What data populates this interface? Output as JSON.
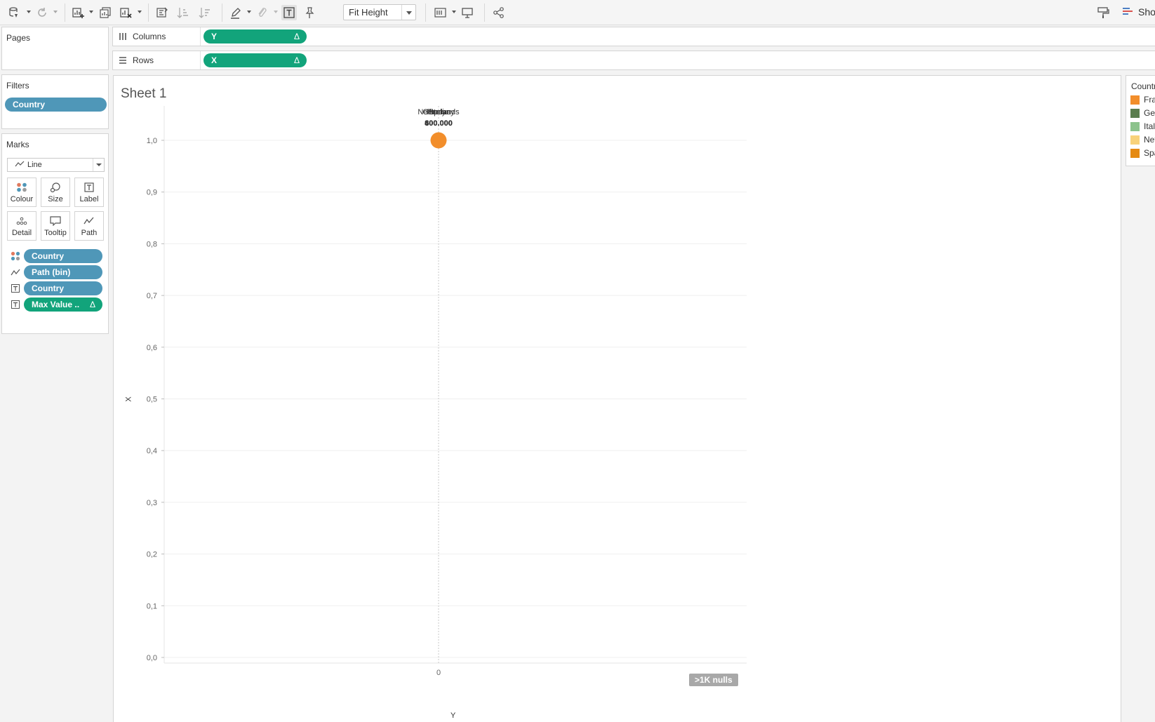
{
  "toolbar": {
    "fit_label": "Fit Height",
    "show_me_label": "Show Me"
  },
  "panels": {
    "pages_title": "Pages",
    "filters_title": "Filters",
    "filters": [
      "Country"
    ],
    "marks_title": "Marks",
    "mark_type": "Line",
    "mark_buttons": [
      "Colour",
      "Size",
      "Label",
      "Detail",
      "Tooltip",
      "Path"
    ],
    "mark_fields": [
      {
        "label": "Country",
        "icon": "colour-icon",
        "color": "#4f97b8"
      },
      {
        "label": "Path (bin)",
        "icon": "path-icon",
        "color": "#4f97b8"
      },
      {
        "label": "Country",
        "icon": "label-icon",
        "color": "#4f97b8"
      },
      {
        "label": "Max Value ..",
        "icon": "label-icon",
        "color": "#12a47b",
        "delta": "Δ"
      }
    ]
  },
  "shelves": {
    "columns_label": "Columns",
    "columns_pill": "Y",
    "rows_label": "Rows",
    "rows_pill": "X",
    "delta": "Δ"
  },
  "sheet": {
    "title": "Sheet 1",
    "nulls_badge": ">1K nulls"
  },
  "chart_data": {
    "type": "scatter",
    "xlabel": "Y",
    "ylabel": "X",
    "x_ticks": [
      "0"
    ],
    "y_ticks": [
      "1,0",
      "0,9",
      "0,8",
      "0,7",
      "0,6",
      "0,5",
      "0,4",
      "0,3",
      "0,2",
      "0,1",
      "0,0"
    ],
    "ylim": [
      0,
      1
    ],
    "points": [
      {
        "x": 0,
        "y": 1.0,
        "color": "#f28e2b"
      }
    ],
    "overlapping_labels": [
      "Netherlands",
      "Germany",
      "Spain",
      "France",
      "Italy"
    ],
    "overlapping_values": [
      "800.000",
      "600.000",
      "400.000"
    ]
  },
  "legend": {
    "title": "Country",
    "items": [
      {
        "label": "France",
        "color": "#f28e2b"
      },
      {
        "label": "Germany",
        "color": "#5a7d4e"
      },
      {
        "label": "Italy",
        "color": "#8cc38c"
      },
      {
        "label": "Netherlands",
        "color": "#f8d27a"
      },
      {
        "label": "Spain",
        "color": "#e58a12"
      }
    ]
  }
}
